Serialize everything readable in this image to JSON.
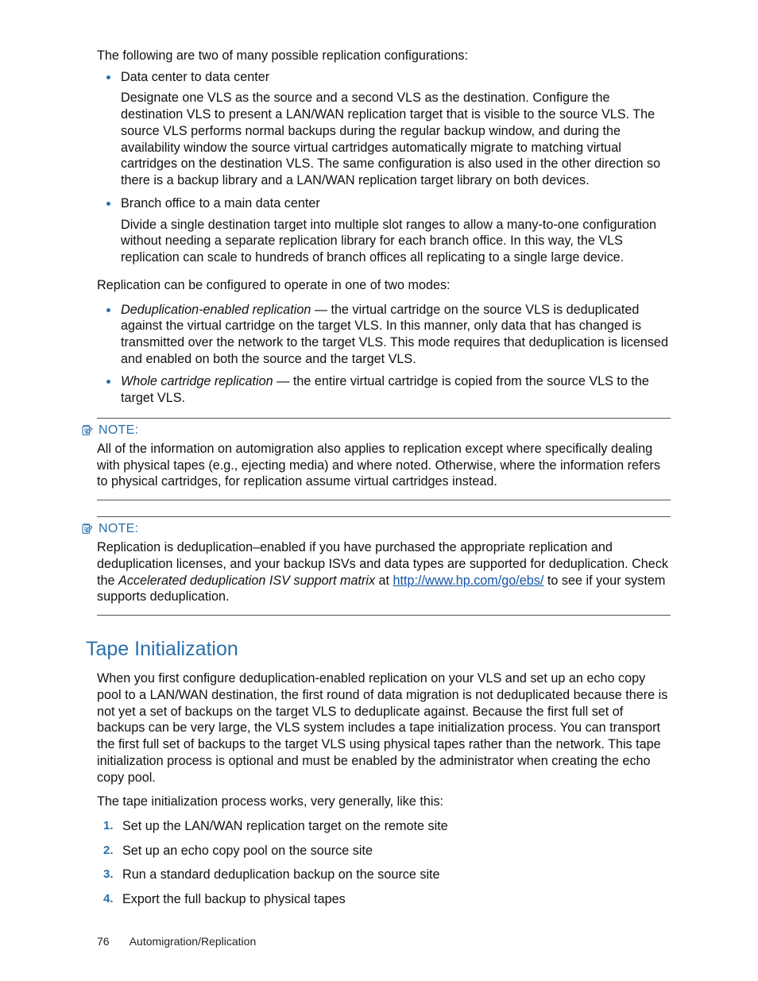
{
  "intro": "The following are two of many possible replication configurations:",
  "configs": [
    {
      "title": "Data center to data center",
      "text": "Designate one VLS as the source and a second VLS as the destination. Configure the destination VLS to present a LAN/WAN replication target that is visible to the source VLS. The source VLS performs normal backups during the regular backup window, and during the availability window the source virtual cartridges automatically migrate to matching virtual cartridges on the destination VLS. The same configuration is also used in the other direction so there is a backup library and a LAN/WAN replication target library on both devices."
    },
    {
      "title": "Branch office to a main data center",
      "text": "Divide a single destination target into multiple slot ranges to allow a many-to-one configuration without needing a separate replication library for each branch office. In this way, the VLS replication can scale to hundreds of branch offices all replicating to a single large device."
    }
  ],
  "modes_intro": "Replication can be configured to operate in one of two modes:",
  "modes": [
    {
      "term": "Deduplication-enabled replication",
      "rest": " — the virtual cartridge on the source VLS is deduplicated against the virtual cartridge on the target VLS. In this manner, only data that has changed is transmitted over the network to the target VLS. This mode requires that deduplication is licensed and enabled on both the source and the target VLS."
    },
    {
      "term": "Whole cartridge replication",
      "rest": " — the entire virtual cartridge is copied from the source VLS to the target VLS."
    }
  ],
  "note1": {
    "label": "NOTE:",
    "text": "All of the information on automigration also applies to replication except where specifically dealing with physical tapes (e.g., ejecting media) and where noted. Otherwise, where the information refers to physical cartridges, for replication assume virtual cartridges instead."
  },
  "note2": {
    "label": "NOTE:",
    "pre": "Replication is deduplication–enabled if you have purchased the appropriate replication and deduplication licenses, and your backup ISVs and data types are supported for deduplication. Check the ",
    "italic": "Accelerated deduplication ISV support matrix",
    "mid": " at ",
    "link_text": "http://www.hp.com/go/ebs/",
    "post": " to see if your system supports deduplication."
  },
  "section_title": "Tape Initialization",
  "section_p1": "When you first configure deduplication-enabled replication on your VLS and set up an echo copy pool to a LAN/WAN destination, the first round of data migration is not deduplicated because there is not yet a set of backups on the target VLS to deduplicate against. Because the first full set of backups can be very large, the VLS system includes a tape initialization process. You can transport the first full set of backups to the target VLS using physical tapes rather than the network. This tape initialization process is optional and must be enabled by the administrator when creating the echo copy pool.",
  "section_p2": "The tape initialization process works, very generally, like this:",
  "steps": [
    "Set up the LAN/WAN replication target on the remote site",
    "Set up an echo copy pool on the source site",
    "Run a standard deduplication backup on the source site",
    "Export the full backup to physical tapes"
  ],
  "footer": {
    "page": "76",
    "title": "Automigration/Replication"
  }
}
